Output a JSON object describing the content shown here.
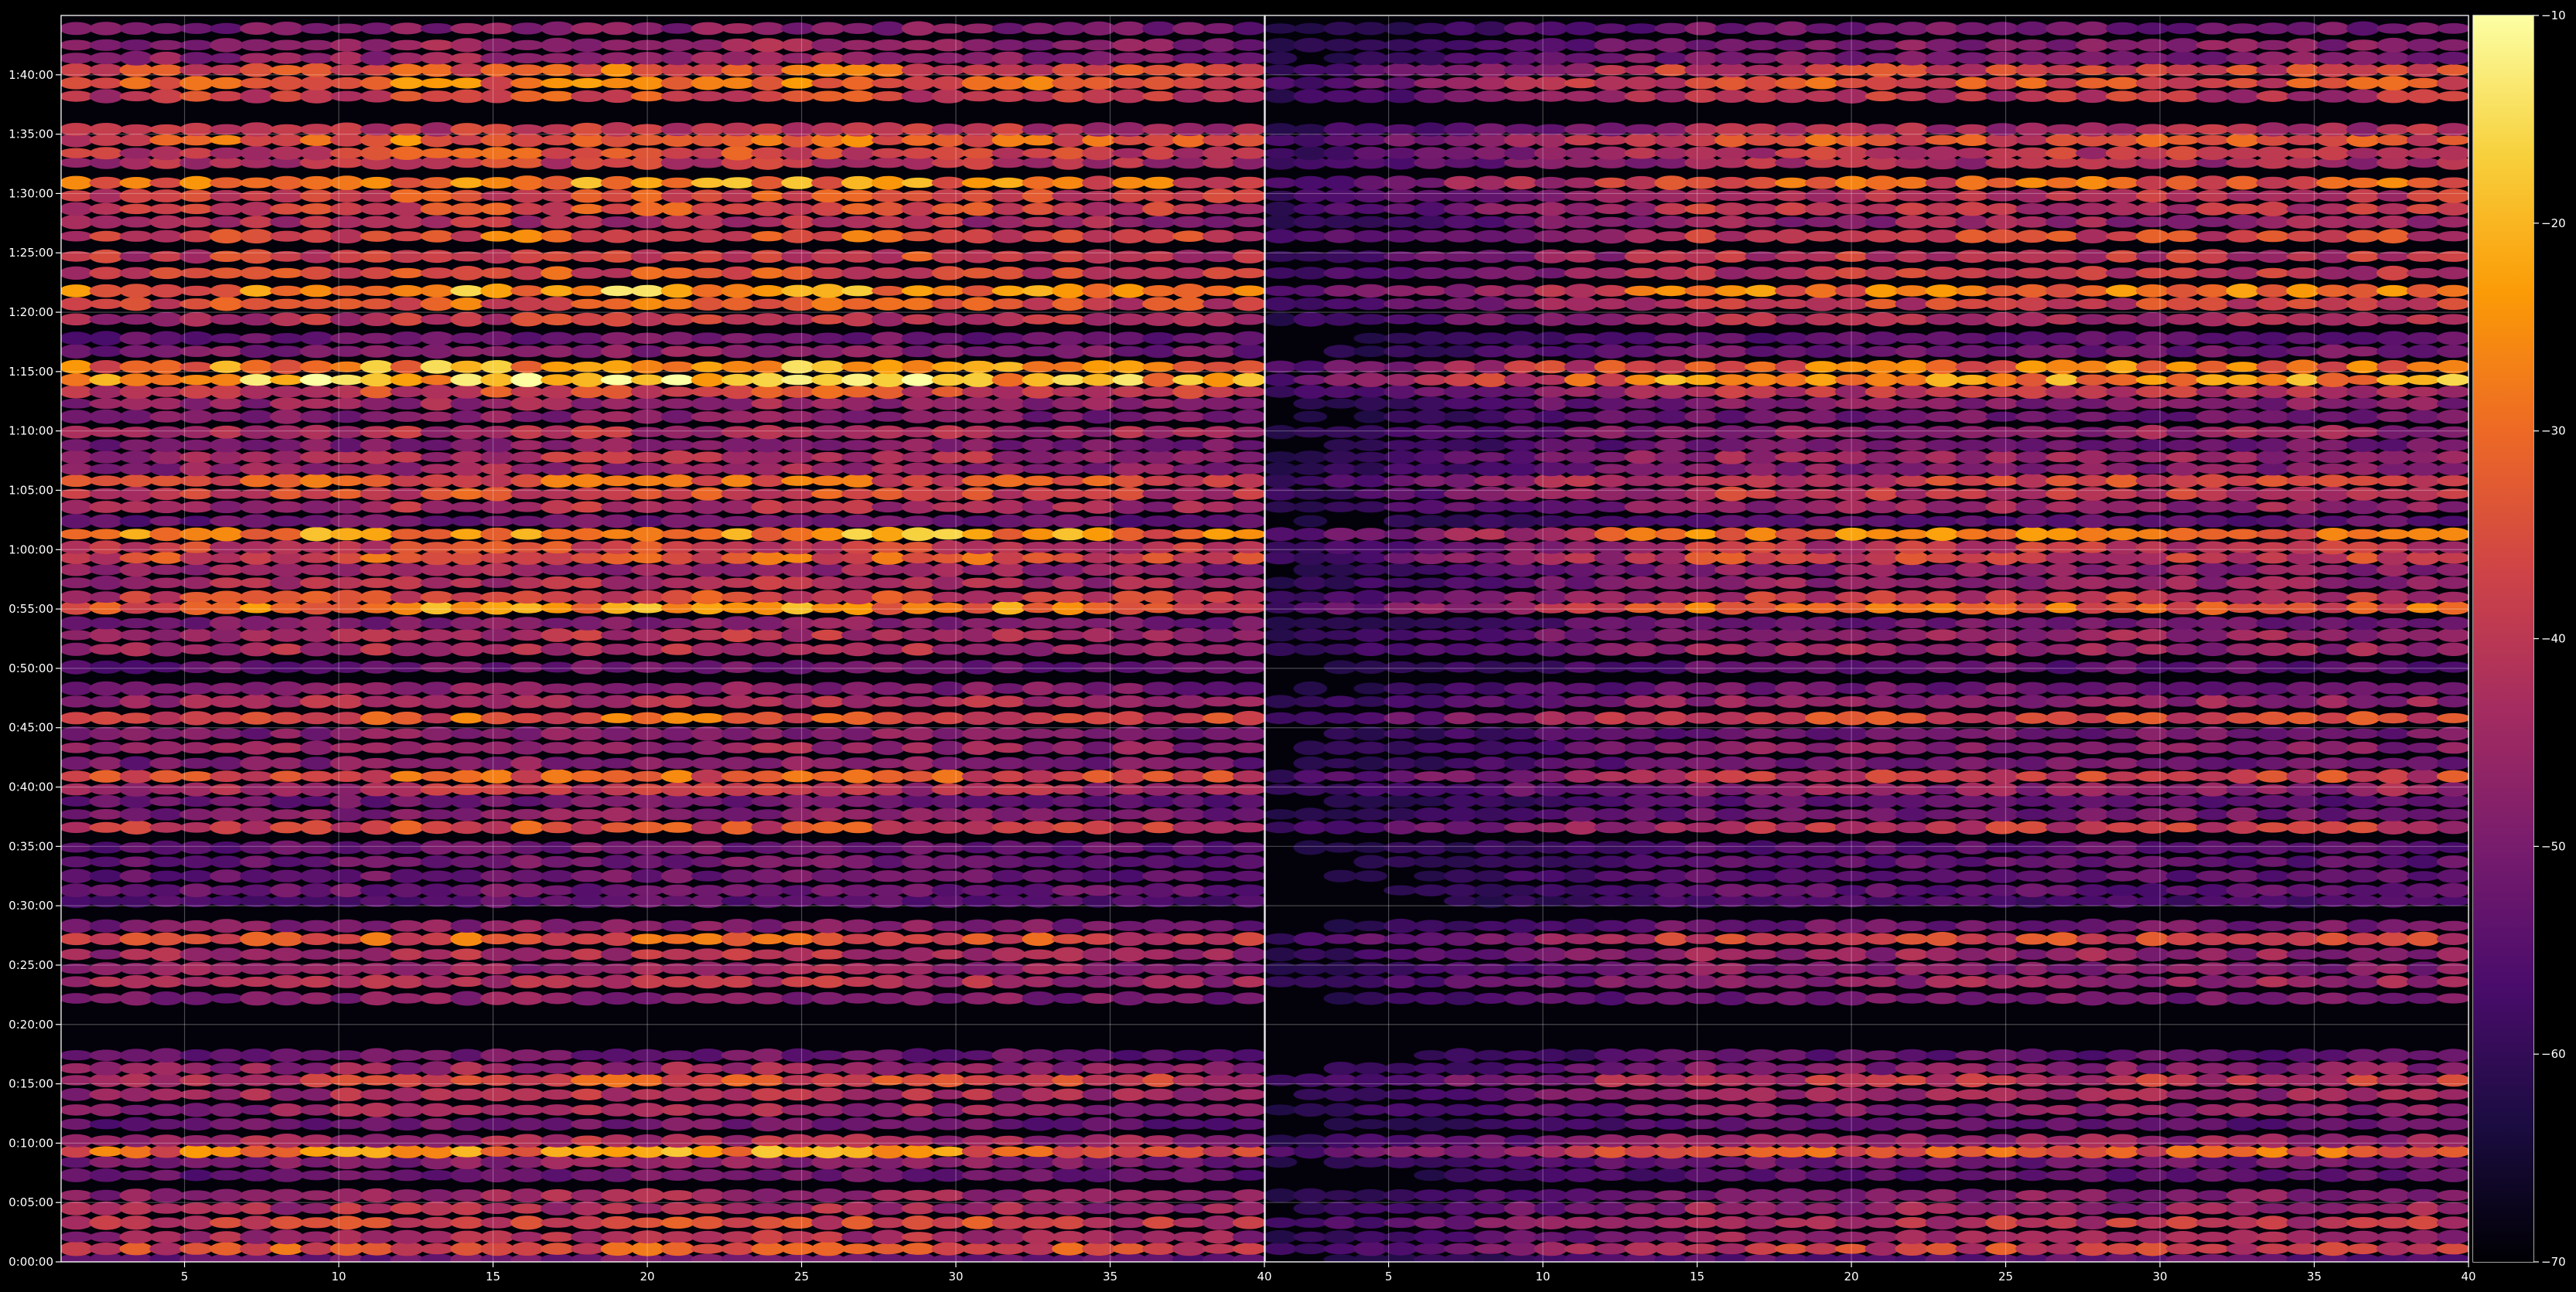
{
  "chart_data": {
    "type": "heatmap",
    "colormap": "inferno",
    "background": "#000000",
    "grid": true,
    "panels": [
      {
        "name": "",
        "xlim": [
          1,
          40
        ],
        "x_ticks": [
          5,
          10,
          15,
          20,
          25,
          30,
          35,
          40
        ],
        "intensity_profile": "strong"
      },
      {
        "name": "",
        "xlim": [
          1,
          40
        ],
        "x_ticks": [
          5,
          10,
          15,
          20,
          25,
          30,
          35,
          40
        ],
        "intensity_profile": "weak"
      }
    ],
    "y_axis": {
      "unit": "time",
      "ylim_seconds": [
        0,
        6300
      ],
      "tick_labels": [
        "0:00:00",
        "0:05:00",
        "0:10:00",
        "0:15:00",
        "0:20:00",
        "0:25:00",
        "0:30:00",
        "0:35:00",
        "0:40:00",
        "0:45:00",
        "0:50:00",
        "0:55:00",
        "1:00:00",
        "1:05:00",
        "1:10:00",
        "1:15:00",
        "1:20:00",
        "1:25:00",
        "1:30:00",
        "1:35:00",
        "1:40:00"
      ]
    },
    "colorbar": {
      "range": [
        -70,
        -10
      ],
      "ticks": [
        -70,
        -60,
        -50,
        -40,
        -30,
        -20,
        -10
      ],
      "tick_labels": [
        "−70",
        "−60",
        "−50",
        "−40",
        "−30",
        "−20",
        "−10"
      ],
      "colors": [
        "#000004",
        "#1b0c41",
        "#4a0c6b",
        "#781c6d",
        "#a52c60",
        "#cf4446",
        "#ed6925",
        "#fb9b06",
        "#f7d13d",
        "#fcffa4"
      ]
    },
    "active_bands_minutes": [
      [
        0.2,
        0.3
      ],
      [
        1.1,
        0.6
      ],
      [
        2.1,
        0.45
      ],
      [
        3.3,
        0.55
      ],
      [
        4.5,
        0.45
      ],
      [
        5.6,
        0.4
      ],
      [
        7.3,
        0.3
      ],
      [
        8.4,
        0.35
      ],
      [
        9.3,
        0.7
      ],
      [
        10.2,
        0.45
      ],
      [
        11.6,
        0.3
      ],
      [
        12.8,
        0.4
      ],
      [
        14.1,
        0.45
      ],
      [
        15.3,
        0.55
      ],
      [
        16.3,
        0.4
      ],
      [
        17.4,
        0.3
      ],
      [
        22.2,
        0.35
      ],
      [
        23.6,
        0.45
      ],
      [
        24.7,
        0.4
      ],
      [
        25.9,
        0.45
      ],
      [
        27.2,
        0.6
      ],
      [
        28.3,
        0.35
      ],
      [
        30.4,
        0.25
      ],
      [
        31.3,
        0.3
      ],
      [
        32.5,
        0.3
      ],
      [
        33.7,
        0.3
      ],
      [
        34.9,
        0.3
      ],
      [
        36.6,
        0.55
      ],
      [
        37.7,
        0.35
      ],
      [
        38.8,
        0.3
      ],
      [
        39.8,
        0.45
      ],
      [
        40.9,
        0.6
      ],
      [
        42.0,
        0.35
      ],
      [
        43.3,
        0.4
      ],
      [
        44.5,
        0.35
      ],
      [
        45.8,
        0.6
      ],
      [
        47.2,
        0.45
      ],
      [
        48.3,
        0.35
      ],
      [
        50.1,
        0.3
      ],
      [
        51.6,
        0.45
      ],
      [
        52.8,
        0.45
      ],
      [
        53.8,
        0.35
      ],
      [
        55.1,
        0.7
      ],
      [
        56.0,
        0.55
      ],
      [
        57.2,
        0.45
      ],
      [
        58.3,
        0.4
      ],
      [
        59.3,
        0.6
      ],
      [
        60.2,
        0.55
      ],
      [
        61.3,
        0.75
      ],
      [
        62.4,
        0.3
      ],
      [
        63.6,
        0.45
      ],
      [
        64.7,
        0.55
      ],
      [
        65.8,
        0.6
      ],
      [
        66.8,
        0.4
      ],
      [
        67.8,
        0.45
      ],
      [
        68.8,
        0.35
      ],
      [
        69.9,
        0.45
      ],
      [
        71.2,
        0.35
      ],
      [
        72.3,
        0.4
      ],
      [
        73.3,
        0.55
      ],
      [
        74.3,
        0.85
      ],
      [
        75.4,
        0.75
      ],
      [
        76.7,
        0.35
      ],
      [
        77.8,
        0.3
      ],
      [
        79.4,
        0.5
      ],
      [
        80.7,
        0.6
      ],
      [
        81.8,
        0.75
      ],
      [
        83.3,
        0.55
      ],
      [
        84.7,
        0.55
      ],
      [
        86.4,
        0.6
      ],
      [
        87.6,
        0.45
      ],
      [
        88.7,
        0.55
      ],
      [
        89.8,
        0.55
      ],
      [
        90.9,
        0.7
      ],
      [
        92.6,
        0.5
      ],
      [
        93.4,
        0.55
      ],
      [
        94.5,
        0.65
      ],
      [
        95.4,
        0.5
      ],
      [
        98.2,
        0.55
      ],
      [
        99.3,
        0.65
      ],
      [
        100.4,
        0.6
      ],
      [
        101.4,
        0.4
      ],
      [
        102.5,
        0.4
      ],
      [
        103.9,
        0.35
      ]
    ]
  }
}
